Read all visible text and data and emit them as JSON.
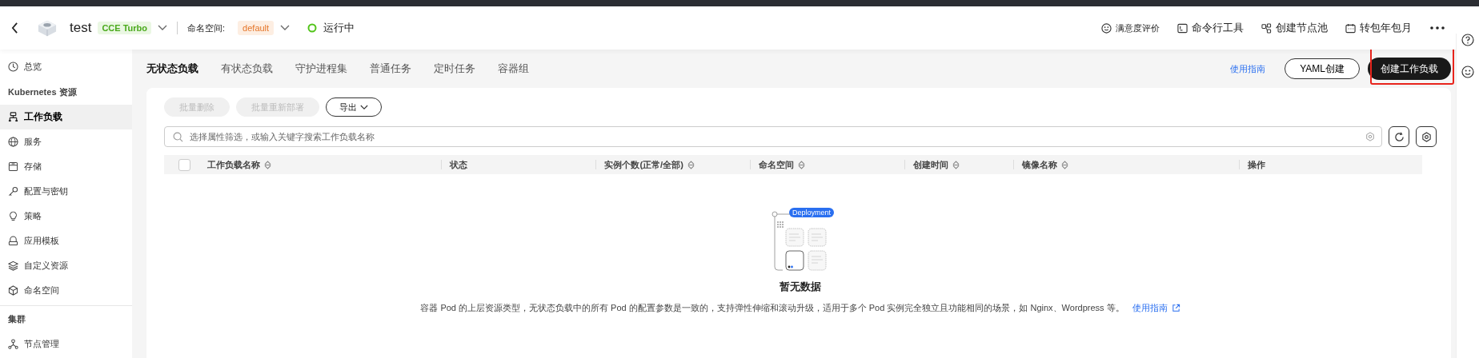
{
  "header": {
    "cluster_name": "test",
    "cluster_badge": "CCE Turbo",
    "namespace_label": "命名空间:",
    "namespace_value": "default",
    "status": {
      "label": "运行中"
    },
    "actions": [
      {
        "label": "满意度评价",
        "kind": "small"
      },
      {
        "label": "命令行工具",
        "kind": "normal"
      },
      {
        "label": "创建节点池",
        "kind": "normal"
      },
      {
        "label": "转包年包月",
        "kind": "normal"
      }
    ]
  },
  "sidebar": {
    "items": [
      {
        "label": "总览",
        "kind": "link",
        "selected": false
      },
      {
        "label": "Kubernetes 资源",
        "kind": "heading"
      },
      {
        "label": "工作负载",
        "kind": "link",
        "selected": true
      },
      {
        "label": "服务",
        "kind": "link",
        "selected": false
      },
      {
        "label": "存储",
        "kind": "link",
        "selected": false
      },
      {
        "label": "配置与密钥",
        "kind": "link",
        "selected": false
      },
      {
        "label": "策略",
        "kind": "link",
        "selected": false
      },
      {
        "label": "应用模板",
        "kind": "link",
        "selected": false
      },
      {
        "label": "自定义资源",
        "kind": "link",
        "selected": false
      },
      {
        "label": "命名空间",
        "kind": "link",
        "selected": false
      },
      {
        "label": "集群",
        "kind": "heading"
      },
      {
        "label": "节点管理",
        "kind": "link",
        "selected": false
      }
    ]
  },
  "tabs": [
    {
      "label": "无状态负载",
      "selected": true
    },
    {
      "label": "有状态负载",
      "selected": false
    },
    {
      "label": "守护进程集",
      "selected": false
    },
    {
      "label": "普通任务",
      "selected": false
    },
    {
      "label": "定时任务",
      "selected": false
    },
    {
      "label": "容器组",
      "selected": false
    }
  ],
  "toolbar": {
    "guide_link": "使用指南",
    "yaml_button": "YAML创建",
    "create_button": "创建工作负载"
  },
  "batch_buttons": [
    {
      "label": "批量删除",
      "disabled": true
    },
    {
      "label": "批量重新部署",
      "disabled": true
    }
  ],
  "export_button": "导出",
  "search": {
    "placeholder": "选择属性筛选，或输入关键字搜索工作负载名称"
  },
  "table": {
    "select_all_checked": false,
    "columns": [
      {
        "label": "工作负载名称",
        "sortable": true
      },
      {
        "label": "状态",
        "sortable": false
      },
      {
        "label": "实例个数(正常/全部)",
        "sortable": true
      },
      {
        "label": "命名空间",
        "sortable": true
      },
      {
        "label": "创建时间",
        "sortable": true
      },
      {
        "label": "镜像名称",
        "sortable": true
      },
      {
        "label": "操作",
        "sortable": false
      }
    ]
  },
  "empty_state": {
    "badge": "Deployment",
    "title": "暂无数据",
    "description": "容器 Pod 的上层资源类型，无状态负载中的所有 Pod 的配置参数是一致的，支持弹性伸缩和滚动升级，适用于多个 Pod 实例完全独立且功能相同的场景，如 Nginx、Wordpress 等。",
    "link": "使用指南"
  }
}
